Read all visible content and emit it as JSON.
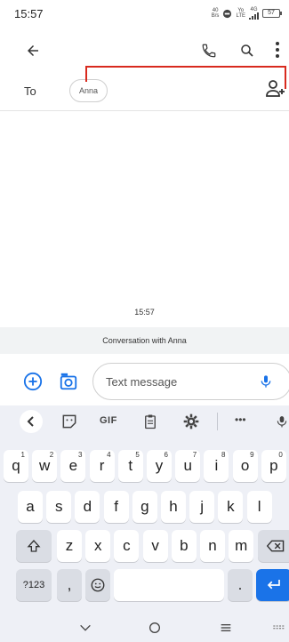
{
  "status_bar": {
    "time": "15:57",
    "net_speed_top": "40",
    "net_speed_bottom": "B/s",
    "volte_top": "Yo",
    "volte_bottom": "LTE",
    "signal_label": "4G",
    "battery": "57"
  },
  "app_bar": {
    "back_icon": "arrow-left-icon",
    "call_icon": "phone-icon",
    "search_icon": "search-icon",
    "more_icon": "more-vertical-icon"
  },
  "recipient": {
    "to_label": "To",
    "chip": "Anna",
    "add_icon": "add-person-icon"
  },
  "thread": {
    "timestamp": "15:57",
    "conversation_label": "Conversation with Anna"
  },
  "compose": {
    "placeholder": "Text message",
    "plus_icon": "plus-circle-icon",
    "camera_icon": "camera-icon",
    "mic_icon": "mic-icon"
  },
  "keyboard": {
    "toolbar": {
      "gif": "GIF",
      "more": "•••"
    },
    "row1": [
      {
        "k": "q",
        "h": "1"
      },
      {
        "k": "w",
        "h": "2"
      },
      {
        "k": "e",
        "h": "3"
      },
      {
        "k": "r",
        "h": "4"
      },
      {
        "k": "t",
        "h": "5"
      },
      {
        "k": "y",
        "h": "6"
      },
      {
        "k": "u",
        "h": "7"
      },
      {
        "k": "i",
        "h": "8"
      },
      {
        "k": "o",
        "h": "9"
      },
      {
        "k": "p",
        "h": "0"
      }
    ],
    "row2": [
      "a",
      "s",
      "d",
      "f",
      "g",
      "h",
      "j",
      "k",
      "l"
    ],
    "row3": [
      "z",
      "x",
      "c",
      "v",
      "b",
      "n",
      "m"
    ],
    "symbols_key": "?123",
    "comma_key": ",",
    "period_key": "."
  },
  "colors": {
    "accent": "#1a73e8",
    "annotation": "#d82a1e",
    "keyboard_bg": "#eef0f6"
  }
}
